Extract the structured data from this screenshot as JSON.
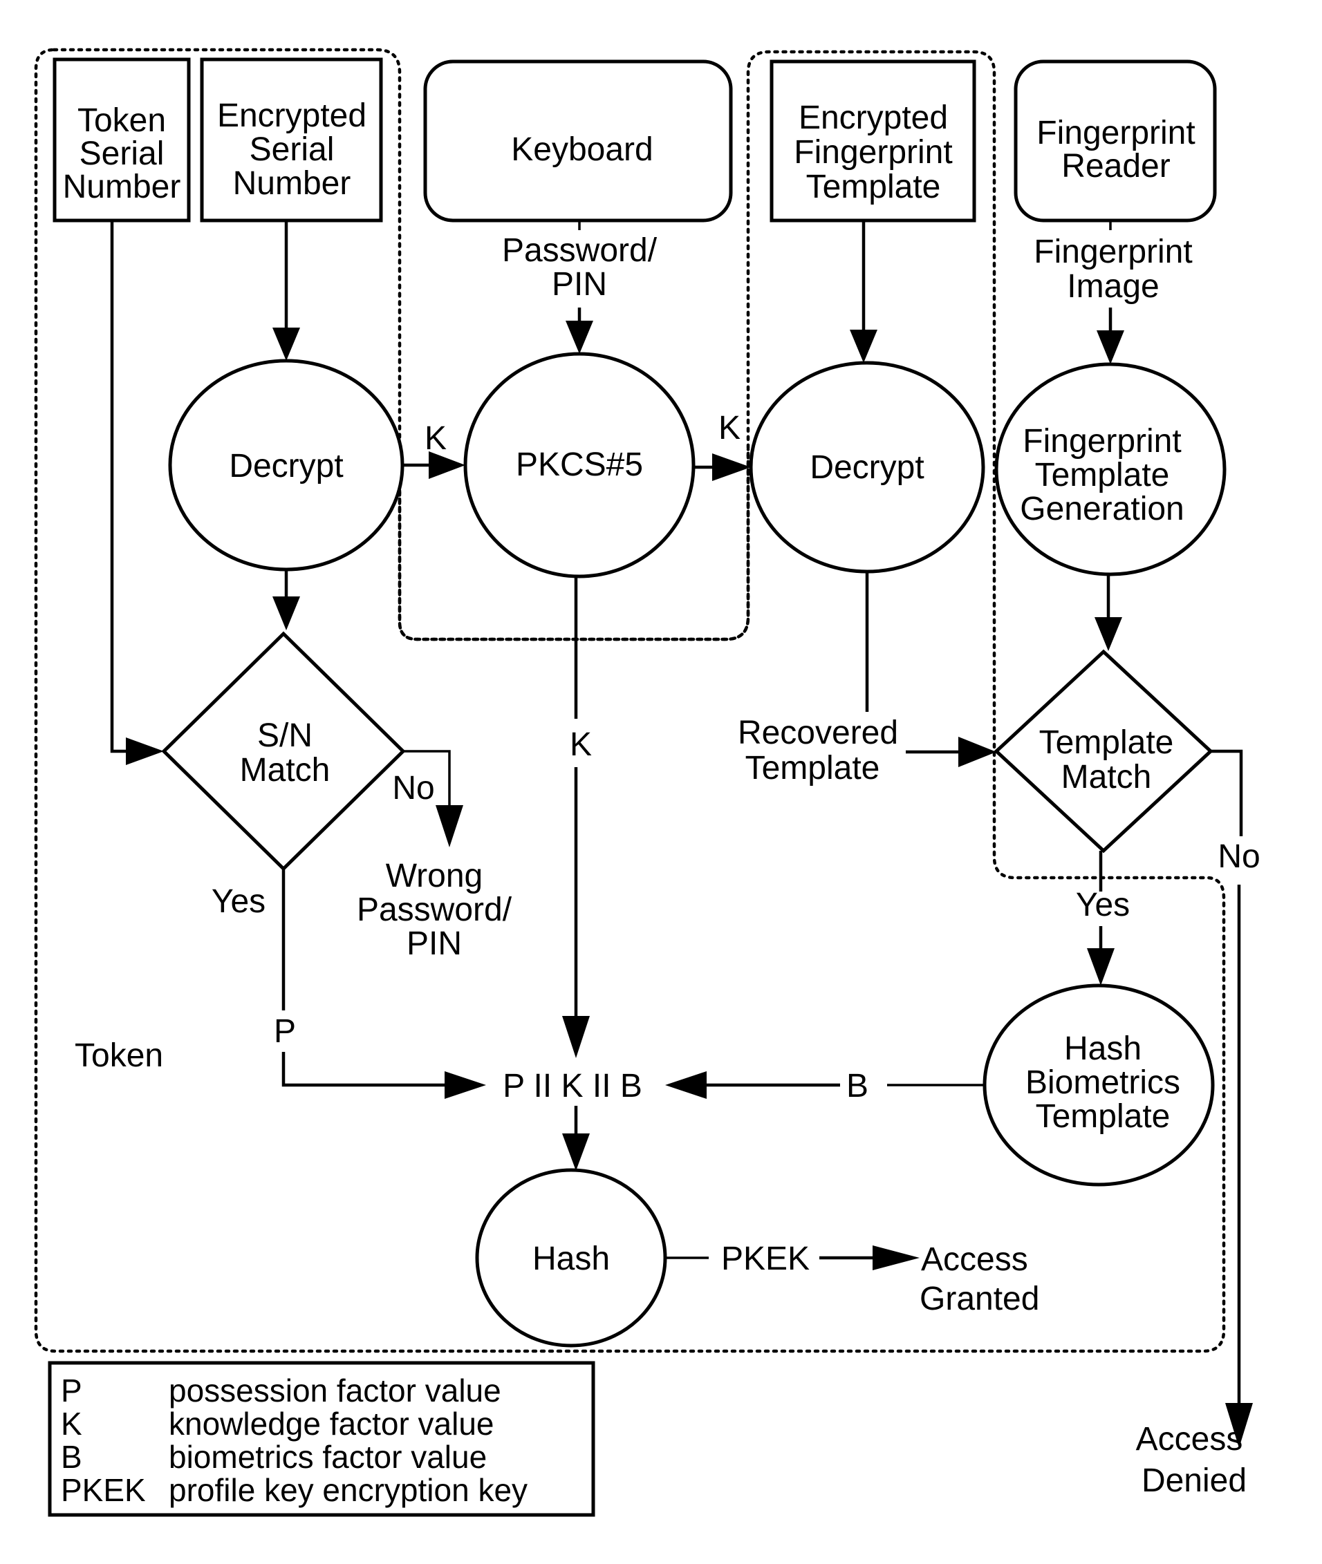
{
  "diagram": {
    "regions": {
      "token": {
        "label": "Token"
      },
      "keyboard_group": {},
      "fingerprint_group": {}
    },
    "nodes": {
      "token_serial": {
        "lines": [
          "Token",
          "Serial",
          "Number"
        ],
        "shape": "rectangle"
      },
      "encrypted_serial": {
        "lines": [
          "Encrypted",
          "Serial",
          "Number"
        ],
        "shape": "rectangle"
      },
      "keyboard": {
        "lines": [
          "Keyboard"
        ],
        "shape": "rounded-rectangle"
      },
      "encrypted_fp_template": {
        "lines": [
          "Encrypted",
          "Fingerprint",
          "Template"
        ],
        "shape": "rectangle"
      },
      "fingerprint_reader": {
        "lines": [
          "Fingerprint",
          "Reader"
        ],
        "shape": "rounded-rectangle"
      },
      "decrypt_sn": {
        "lines": [
          "Decrypt"
        ],
        "shape": "ellipse"
      },
      "pkcs5": {
        "lines": [
          "PKCS#5"
        ],
        "shape": "ellipse"
      },
      "decrypt_fp": {
        "lines": [
          "Decrypt"
        ],
        "shape": "ellipse"
      },
      "fp_template_gen": {
        "lines": [
          "Fingerprint",
          "Template",
          "Generation"
        ],
        "shape": "ellipse"
      },
      "sn_match": {
        "lines": [
          "S/N",
          "Match"
        ],
        "shape": "diamond"
      },
      "template_match": {
        "lines": [
          "Template",
          "Match"
        ],
        "shape": "diamond"
      },
      "hash_biometrics": {
        "lines": [
          "Hash",
          "Biometrics",
          "Template"
        ],
        "shape": "ellipse"
      },
      "concat": {
        "text": "P II K II B"
      },
      "hash": {
        "lines": [
          "Hash"
        ],
        "shape": "ellipse"
      }
    },
    "edge_labels": {
      "password_pin": [
        "Password/",
        "PIN"
      ],
      "fingerprint_image": [
        "Fingerprint",
        "Image"
      ],
      "k_decrypt_to_pkcs": "K",
      "k_pkcs_to_decrypt": "K",
      "k_down": "K",
      "recovered_template": [
        "Recovered",
        "Template"
      ],
      "sn_no": "No",
      "sn_yes": "Yes",
      "wrong_password": [
        "Wrong",
        "Password/",
        "PIN"
      ],
      "p": "P",
      "b": "B",
      "tm_yes": "Yes",
      "tm_no": "No",
      "pkek": "PKEK",
      "access_granted": [
        "Access",
        "Granted"
      ],
      "access_denied": [
        "Access",
        "Denied"
      ]
    },
    "legend": [
      {
        "key": "P",
        "desc": "possession factor value"
      },
      {
        "key": "K",
        "desc": "knowledge factor value"
      },
      {
        "key": "B",
        "desc": "biometrics factor value"
      },
      {
        "key": "PKEK",
        "desc": "profile key encryption key"
      }
    ]
  }
}
